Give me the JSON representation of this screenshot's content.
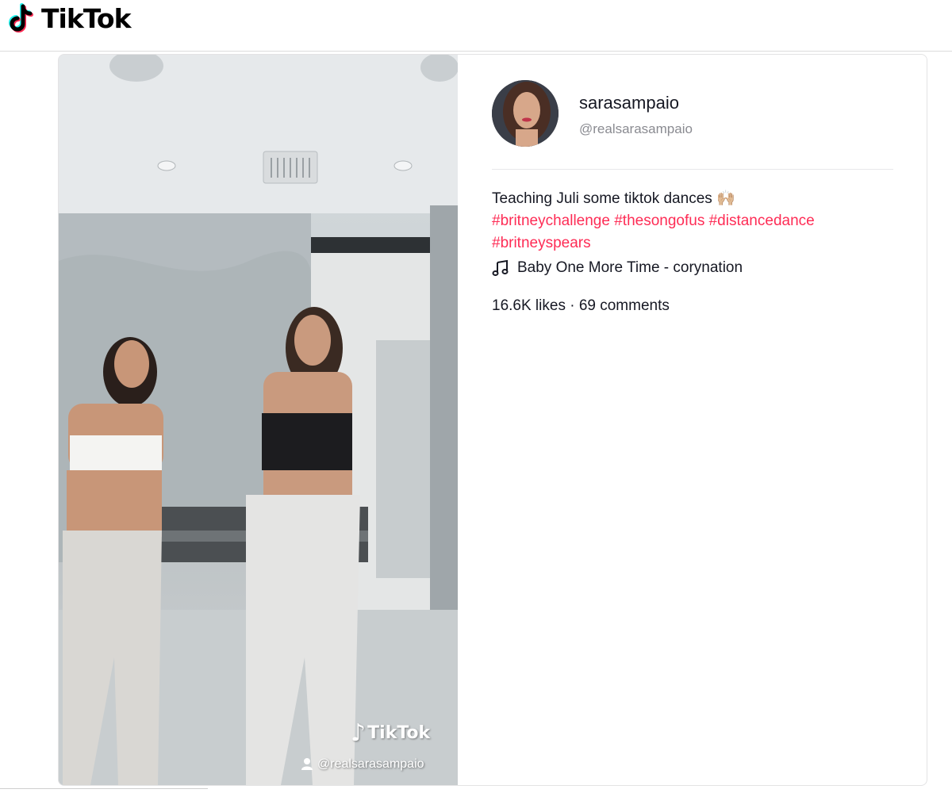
{
  "header": {
    "logo_text": "TikTok",
    "logo_icon": "tiktok-note-icon"
  },
  "post": {
    "username": "sarasampaio",
    "handle": "@realsarasampaio",
    "caption_text": "Teaching Juli some tiktok dances",
    "caption_emoji": "🙌🏼",
    "hashtags": [
      "#britneychallenge",
      "#thesongofus",
      "#distancedance",
      "#britneyspears"
    ],
    "music_icon": "music-note-icon",
    "music": "Baby One More Time - corynation",
    "stats": "16.6K likes · 69 comments",
    "video": {
      "watermark_logo": "TikTok",
      "watermark_user": "@realsarasampaio"
    }
  },
  "colors": {
    "accent": "#fe2c55",
    "text": "#161823",
    "muted": "#8a8b91",
    "logo_cyan": "#25f4ee",
    "logo_red": "#fe2c55"
  }
}
